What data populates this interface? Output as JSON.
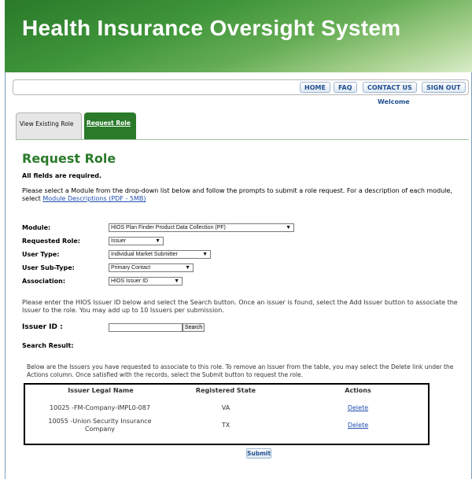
{
  "header": {
    "title": "Health Insurance Oversight System"
  },
  "nav": {
    "home": "HOME",
    "faq": "FAQ",
    "contact": "CONTACT US",
    "signout": "SIGN OUT",
    "welcome": "Welcome"
  },
  "tabs": {
    "existing": "View Existing Role",
    "request": "Request Role"
  },
  "page": {
    "heading": "Request Role",
    "required": "All fields are required.",
    "intro": "Please select a Module from the drop-down list below and follow the prompts to submit a role request. For a description of each module, select",
    "intro_link": "Module Descriptions (PDF - 5MB)"
  },
  "form": {
    "module": {
      "label": "Module:",
      "value": "HIOS Plan Finder Product Data Collection (PF)"
    },
    "role": {
      "label": "Requested Role:",
      "value": "Issuer"
    },
    "user_type": {
      "label": "User Type:",
      "value": "Individual Market Submitter"
    },
    "user_subtype": {
      "label": "User Sub-Type:",
      "value": "Primary Contact"
    },
    "association": {
      "label": "Association:",
      "value": "HIOS Issuer ID"
    }
  },
  "issuer": {
    "help": "Please enter the HIOS Issuer ID below and select the Search button. Once an issuer is found, select the Add Issuer button to associate the Issuer to the role. You may add up to 10 Issuers per submission.",
    "label": "Issuer ID :",
    "input_value": "",
    "search_label": "Search"
  },
  "results": {
    "label": "Search Result:",
    "note": "Below are the Issuers you have requested to associate to this role. To remove an Issuer from the table, you may select the Delete link under the Actions column. Once satisfied with the records, select the Submit button to request the role.",
    "columns": [
      "Issuer Legal Name",
      "Registered State",
      "Actions"
    ],
    "rows": [
      {
        "name": "10025 -FM-Company-IMPL0-087",
        "state": "VA",
        "action": "Delete"
      },
      {
        "name": "10055 -Union Security Insurance Company",
        "state": "TX",
        "action": "Delete"
      }
    ]
  },
  "submit_label": "Submit"
}
